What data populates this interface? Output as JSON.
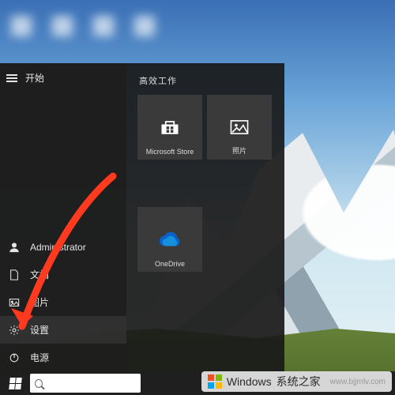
{
  "start_menu": {
    "title": "开始",
    "rail": {
      "user": "Administrator",
      "documents": "文档",
      "pictures": "图片",
      "settings": "设置",
      "power": "电源"
    },
    "tile_group_label": "高效工作",
    "tiles": {
      "store": "Microsoft Store",
      "photos": "照片",
      "onedrive": "OneDrive"
    }
  },
  "taskbar": {
    "search_placeholder": ""
  },
  "watermark": {
    "brand": "Windows",
    "site_cn": "系统之家",
    "url": "www.bjjmlv.com"
  }
}
